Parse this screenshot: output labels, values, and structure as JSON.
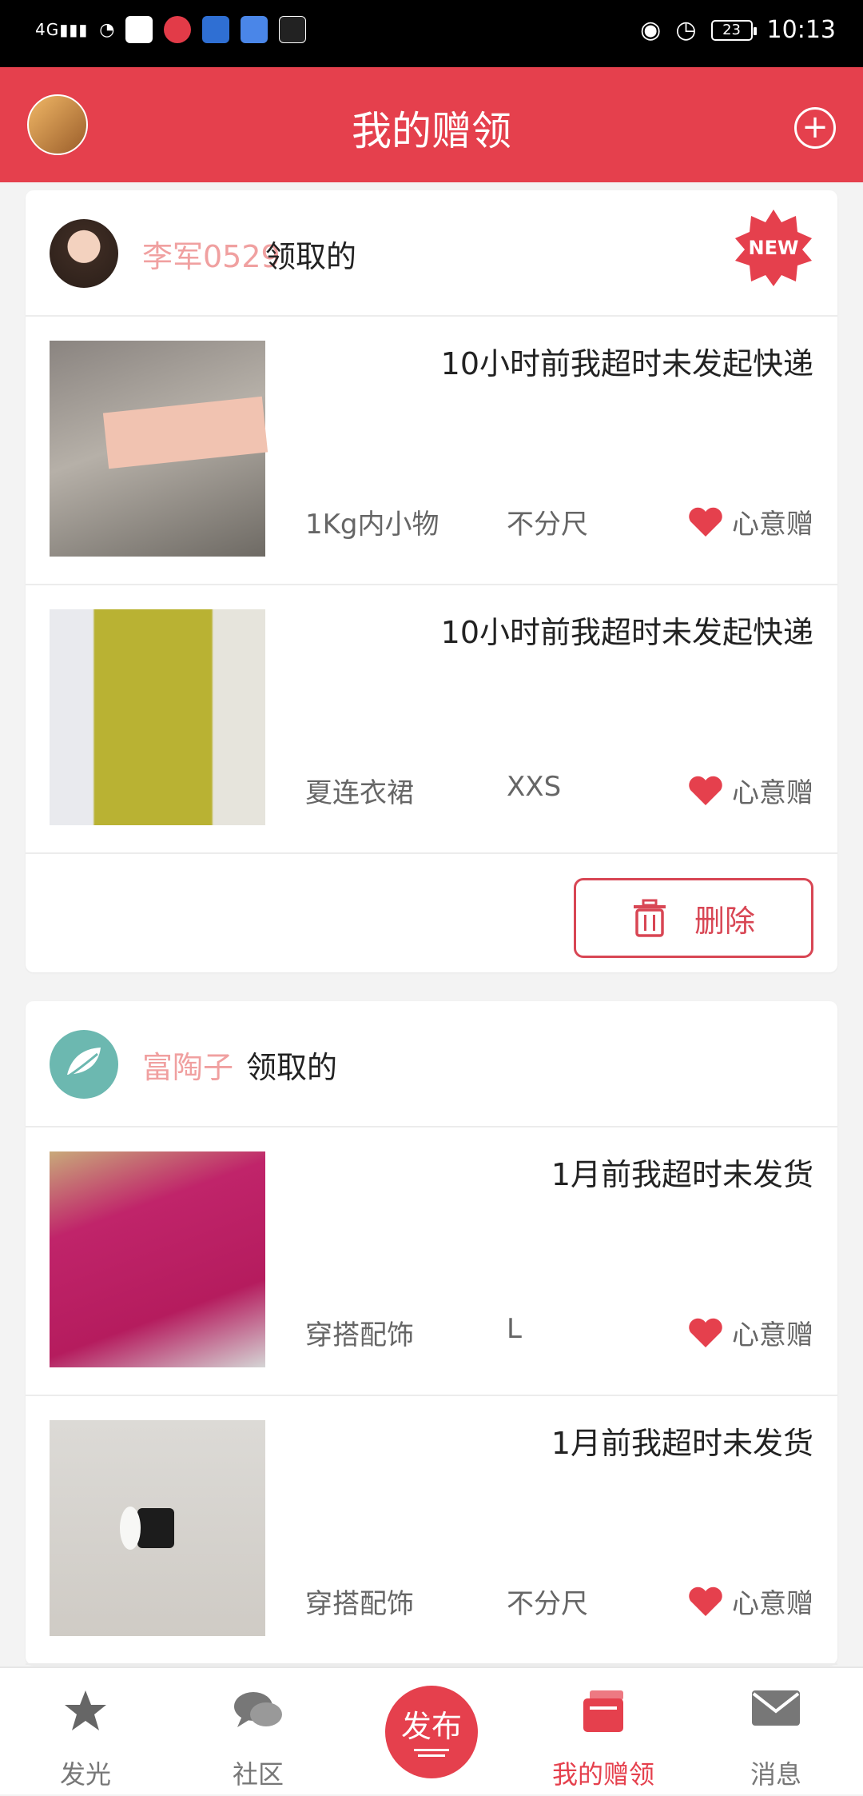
{
  "status_bar": {
    "network": "4G",
    "time": "10:13",
    "battery": "23"
  },
  "header": {
    "title": "我的赠领"
  },
  "cards": [
    {
      "user": "李军0529",
      "action": "领取的",
      "badge": "NEW",
      "items": [
        {
          "status": "10小时前我超时未发起快递",
          "category": "1Kg内小物",
          "size": "不分尺",
          "gift_label": "心意赠"
        },
        {
          "status": "10小时前我超时未发起快递",
          "category": "夏连衣裙",
          "size": "XXS",
          "gift_label": "心意赠"
        }
      ],
      "delete_label": "删除"
    },
    {
      "user": "富陶子",
      "action": "领取的",
      "items": [
        {
          "status": "1月前我超时未发货",
          "category": "穿搭配饰",
          "size": "L",
          "gift_label": "心意赠"
        },
        {
          "status": "1月前我超时未发货",
          "category": "穿搭配饰",
          "size": "不分尺",
          "gift_label": "心意赠"
        }
      ]
    }
  ],
  "tabbar": {
    "items": [
      {
        "label": "发光",
        "icon": "star-icon"
      },
      {
        "label": "社区",
        "icon": "chat-icon"
      },
      {
        "label": "发布",
        "icon": "publish-icon"
      },
      {
        "label": "我的赠领",
        "icon": "gift-box-icon"
      },
      {
        "label": "消息",
        "icon": "mail-icon"
      }
    ],
    "active": "我的赠领"
  },
  "colors": {
    "brand": "#e5404d",
    "username": "#f0a0a0",
    "heart": "#e5404d"
  }
}
